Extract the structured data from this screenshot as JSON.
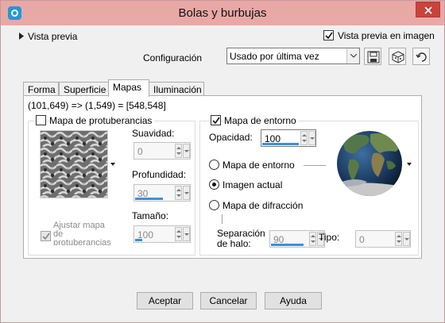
{
  "window": {
    "title": "Bolas y burbujas"
  },
  "header": {
    "preview_toggle_label": "Vista previa",
    "preview_in_image_label": "Vista previa en imagen",
    "preview_in_image_checked": true,
    "config_label": "Configuración",
    "config_value": "Usado por última vez"
  },
  "tabs": [
    {
      "label": "Forma",
      "active": false
    },
    {
      "label": "Superficie",
      "active": false
    },
    {
      "label": "Mapas",
      "active": true
    },
    {
      "label": "Iluminación",
      "active": false
    }
  ],
  "coords_text": "(101,649) => (1,549) = [548,548]",
  "bump": {
    "title": "Mapa de protuberancias",
    "checked": false,
    "smoothness": {
      "label": "Suavidad:",
      "value": "0",
      "fill": 0
    },
    "depth": {
      "label": "Profundidad:",
      "value": "30",
      "fill": 0.75
    },
    "size": {
      "label": "Tamaño:",
      "value": "100",
      "fill": 0.2
    },
    "fit_label_line1": "Ajustar mapa",
    "fit_label_line2": "de",
    "fit_label_line3": "protuberancias",
    "fit_checked": true
  },
  "env": {
    "title": "Mapa de entorno",
    "checked": true,
    "opacity": {
      "label": "Opacidad:",
      "value": "100",
      "fill": 1
    },
    "radio_env_label": "Mapa de entorno",
    "radio_current_label": "Imagen actual",
    "radio_diffraction_label": "Mapa de difracción",
    "selected": "current",
    "halo_label_line1": "Separación",
    "halo_label_line2": "de halo:",
    "halo": {
      "value": "90",
      "fill": 0.9
    },
    "type_label": "Tipo:",
    "type_value": "0"
  },
  "footer": {
    "ok": "Aceptar",
    "cancel": "Cancelar",
    "help": "Ayuda"
  },
  "colors": {
    "titlebar": "#e8a8a6",
    "accent": "#3c8fd8",
    "close": "#c9433a"
  }
}
